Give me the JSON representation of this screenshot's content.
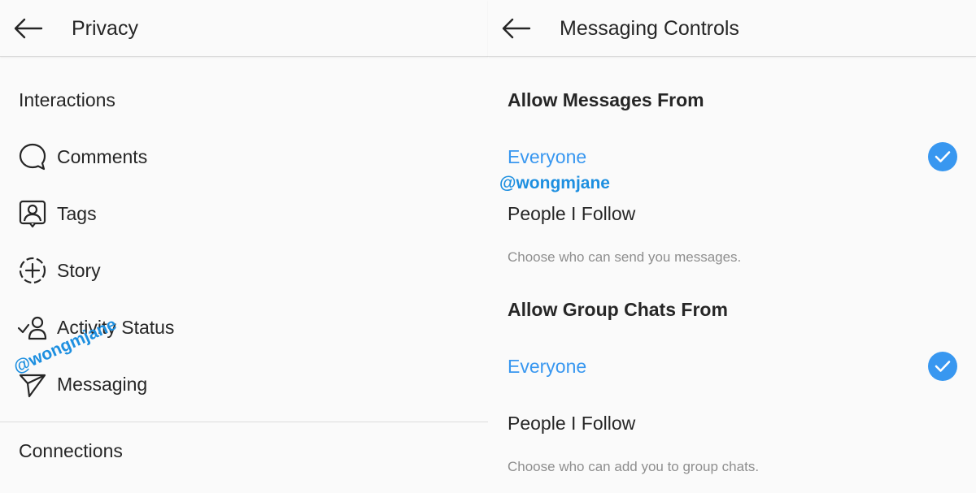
{
  "left": {
    "title": "Privacy",
    "sections": {
      "interactions": "Interactions",
      "connections": "Connections"
    },
    "items": [
      {
        "label": "Comments",
        "icon": "comment-icon"
      },
      {
        "label": "Tags",
        "icon": "tag-icon"
      },
      {
        "label": "Story",
        "icon": "story-icon"
      },
      {
        "label": "Activity Status",
        "icon": "activity-status-icon"
      },
      {
        "label": "Messaging",
        "icon": "messaging-icon"
      }
    ]
  },
  "right": {
    "title": "Messaging Controls",
    "messages": {
      "heading": "Allow Messages From",
      "options": [
        "Everyone",
        "People I Follow"
      ],
      "selected": "Everyone",
      "helper": "Choose who can send you messages."
    },
    "groups": {
      "heading": "Allow Group Chats From",
      "options": [
        "Everyone",
        "People I Follow"
      ],
      "selected": "Everyone",
      "helper": "Choose who can add you to group chats."
    }
  },
  "watermark": "@wongmjane",
  "colors": {
    "accent": "#3897f0",
    "text": "#262626",
    "muted": "#8e8e8e",
    "background": "#fafafa",
    "watermark": "#1d8fe0"
  }
}
